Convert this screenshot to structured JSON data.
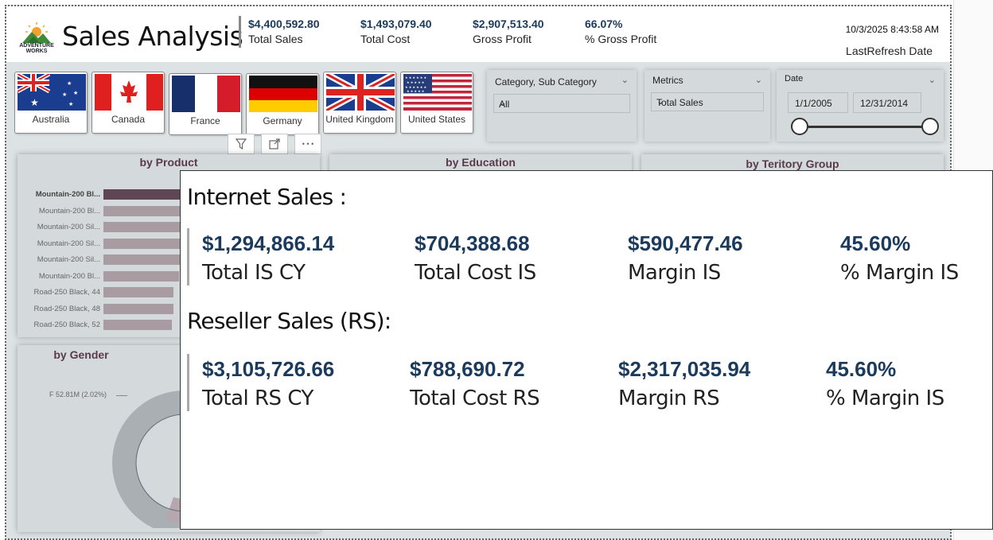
{
  "header": {
    "logo_text": "ADVENTURE WORKS",
    "title": "Sales Analysis",
    "kpis": [
      {
        "value": "$4,400,592.80",
        "label": "Total Sales"
      },
      {
        "value": "$1,493,079.40",
        "label": "Total Cost"
      },
      {
        "value": "$2,907,513.40",
        "label": "Gross Profit"
      },
      {
        "value": "66.07%",
        "label": "% Gross Profit"
      }
    ],
    "refresh_date": "10/3/2025 8:43:58 AM",
    "refresh_label": "LastRefresh Date"
  },
  "countries": [
    {
      "label": "Australia",
      "flag": "australia-flag"
    },
    {
      "label": "Canada",
      "flag": "canada-flag"
    },
    {
      "label": "France",
      "flag": "france-flag"
    },
    {
      "label": "Germany",
      "flag": "germany-flag"
    },
    {
      "label": "United Kingdom",
      "flag": "uk-flag"
    },
    {
      "label": "United States",
      "flag": "us-flag"
    }
  ],
  "slicers": {
    "category": {
      "title": "Category, Sub Category",
      "value": "All"
    },
    "metrics": {
      "title": "Metrics",
      "value": "Total Sales"
    },
    "date": {
      "title": "Date",
      "start": "1/1/2005",
      "end": "12/31/2014"
    }
  },
  "toolbar": {
    "filter_icon": "filter-icon",
    "focus_icon": "focus-mode-icon",
    "more_label": "• • •"
  },
  "panels": {
    "product": {
      "title": "by Product",
      "rows": [
        {
          "label": "Mountain-200 Bl...",
          "bold": true,
          "fill": 0.95
        },
        {
          "label": "Mountain-200 Bl...",
          "fill": 0.9
        },
        {
          "label": "Mountain-200 Sil...",
          "fill": 0.9
        },
        {
          "label": "Mountain-200 Sil...",
          "fill": 0.88
        },
        {
          "label": "Mountain-200 Sil...",
          "fill": 0.87
        },
        {
          "label": "Mountain-200 Bl...",
          "fill": 0.86
        },
        {
          "label": "Road-250 Black, 44",
          "fill": 0.8
        },
        {
          "label": "Road-250 Black, 48",
          "fill": 0.8
        },
        {
          "label": "Road-250 Black, 52",
          "fill": 0.78
        }
      ]
    },
    "education": {
      "title": "by Education"
    },
    "territory": {
      "title": "by Teritory Group"
    },
    "gender": {
      "title": "by Gender",
      "slice_label": "F 52.81M (2.02%)"
    }
  },
  "tooltip": {
    "internet_title": "Internet Sales :",
    "internet": [
      {
        "value": "$1,294,866.14",
        "label": "Total IS CY"
      },
      {
        "value": "$704,388.68",
        "label": "Total Cost IS"
      },
      {
        "value": "$590,477.46",
        "label": "Margin IS"
      },
      {
        "value": "45.60%",
        "label": "% Margin IS"
      }
    ],
    "reseller_title": "Reseller Sales (RS):",
    "reseller": [
      {
        "value": "$3,105,726.66",
        "label": "Total RS CY"
      },
      {
        "value": "$788,690.72",
        "label": "Total Cost RS"
      },
      {
        "value": "$2,317,035.94",
        "label": "Margin RS"
      },
      {
        "value": "45.60%",
        "label": "% Margin IS"
      }
    ]
  },
  "colors": {
    "kpi": "#1b3a5c",
    "bar": "#a89ca2",
    "bar_selected": "#5e4655",
    "background": "#dde3e5"
  }
}
